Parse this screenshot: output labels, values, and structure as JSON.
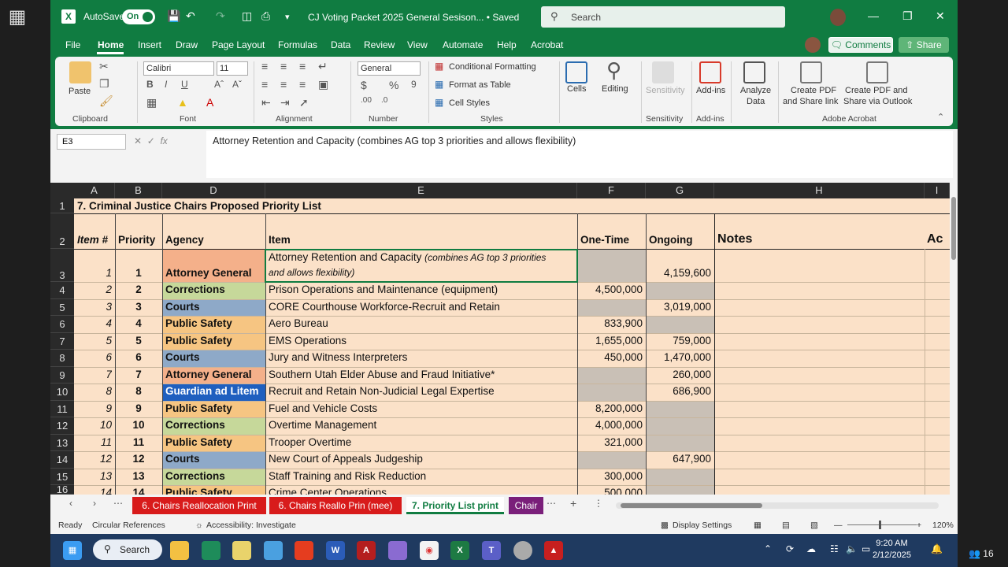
{
  "title_bar": {
    "autosave_label": "AutoSave",
    "autosave_state": "On",
    "doc_title": "CJ Voting Packet 2025 General Sesison... • Saved",
    "search_placeholder": "Search"
  },
  "menu": {
    "items": [
      "File",
      "Home",
      "Insert",
      "Draw",
      "Page Layout",
      "Formulas",
      "Data",
      "Review",
      "View",
      "Automate",
      "Help",
      "Acrobat"
    ],
    "active": "Home",
    "comments": "Comments",
    "share": "Share"
  },
  "ribbon": {
    "paste": "Paste",
    "font_name": "Calibri",
    "font_size": "11",
    "number_format": "General",
    "conditional_formatting": "Conditional Formatting",
    "format_as_table": "Format as Table",
    "cell_styles": "Cell Styles",
    "cells": "Cells",
    "editing": "Editing",
    "sensitivity": "Sensitivity",
    "add_ins": "Add-ins",
    "analyze_data_1": "Analyze",
    "analyze_data_2": "Data",
    "create_pdf_link_1": "Create PDF",
    "create_pdf_link_2": "and Share link",
    "create_pdf_outlook_1": "Create PDF and",
    "create_pdf_outlook_2": "Share via Outlook",
    "groups": {
      "clipboard": "Clipboard",
      "font": "Font",
      "alignment": "Alignment",
      "number": "Number",
      "styles": "Styles",
      "sensitivity": "Sensitivity",
      "add_ins": "Add-ins",
      "adobe_acrobat": "Adobe Acrobat"
    }
  },
  "formula_bar": {
    "name_box": "E3",
    "fx": "fx",
    "formula": "Attorney Retention and Capacity (combines AG top 3 priorities and allows flexibility)"
  },
  "sheet": {
    "columns": [
      "A",
      "B",
      "D",
      "E",
      "F",
      "G",
      "H",
      "I"
    ],
    "title": "7. Criminal Justice Chairs Proposed Priority List",
    "headers": {
      "item": "Item #",
      "priority": "Priority",
      "agency": "Agency",
      "item_name": "Item",
      "one_time": "One-Time",
      "ongoing": "Ongoing",
      "notes": "Notes",
      "next": "Ac"
    },
    "row3": {
      "item": "1",
      "priority": "1",
      "agency": "Attorney General",
      "name_line1": "Attorney Retention and Capacity ",
      "name_line1_italic": "(combines AG top 3 priorities",
      "name_line2": "and allows flexibility)",
      "one_time": "",
      "ongoing": "4,159,600"
    },
    "rows": [
      {
        "row": "4",
        "item": "2",
        "priority": "2",
        "agency": "Corrections",
        "name": "Prison Operations and Maintenance (equipment)",
        "one_time": "4,500,000",
        "ongoing": ""
      },
      {
        "row": "5",
        "item": "3",
        "priority": "3",
        "agency": "Courts",
        "name": "CORE Courthouse Workforce-Recruit and Retain",
        "one_time": "",
        "ongoing": "3,019,000"
      },
      {
        "row": "6",
        "item": "4",
        "priority": "4",
        "agency": "Public Safety",
        "name": "Aero Bureau",
        "one_time": "833,900",
        "ongoing": ""
      },
      {
        "row": "7",
        "item": "5",
        "priority": "5",
        "agency": "Public Safety",
        "name": "EMS Operations",
        "one_time": "1,655,000",
        "ongoing": "759,000"
      },
      {
        "row": "8",
        "item": "6",
        "priority": "6",
        "agency": "Courts",
        "name": "Jury and Witness Interpreters",
        "one_time": "450,000",
        "ongoing": "1,470,000"
      },
      {
        "row": "9",
        "item": "7",
        "priority": "7",
        "agency": "Attorney General",
        "name": "Southern Utah Elder Abuse and Fraud Initiative*",
        "one_time": "",
        "ongoing": "260,000"
      },
      {
        "row": "10",
        "item": "8",
        "priority": "8",
        "agency": "Guardian ad Litem",
        "name": "Recruit and Retain Non-Judicial Legal Expertise",
        "one_time": "",
        "ongoing": "686,900"
      },
      {
        "row": "11",
        "item": "9",
        "priority": "9",
        "agency": "Public Safety",
        "name": "Fuel and Vehicle Costs",
        "one_time": "8,200,000",
        "ongoing": ""
      },
      {
        "row": "12",
        "item": "10",
        "priority": "10",
        "agency": "Corrections",
        "name": "Overtime Management",
        "one_time": "4,000,000",
        "ongoing": ""
      },
      {
        "row": "13",
        "item": "11",
        "priority": "11",
        "agency": "Public Safety",
        "name": "Trooper Overtime",
        "one_time": "321,000",
        "ongoing": ""
      },
      {
        "row": "14",
        "item": "12",
        "priority": "12",
        "agency": "Courts",
        "name": "New Court of Appeals Judgeship",
        "one_time": "",
        "ongoing": "647,900"
      },
      {
        "row": "15",
        "item": "13",
        "priority": "13",
        "agency": "Corrections",
        "name": "Staff Training and Risk Reduction",
        "one_time": "300,000",
        "ongoing": ""
      },
      {
        "row": "16",
        "item": "14",
        "priority": "14",
        "agency": "Public Safety",
        "name": "Crime Center Operations",
        "one_time": "500,000",
        "ongoing": ""
      }
    ],
    "agency_colors": {
      "Attorney General": "#f4b08a",
      "Corrections": "#c6d89a",
      "Courts": "#8ea9c8",
      "Public Safety": "#f6c582",
      "Guardian ad Litem": "#1f5fbf"
    }
  },
  "sheet_tabs": [
    {
      "label": "6. Chairs Reallocation Print",
      "color": "#d81b1b",
      "active": false
    },
    {
      "label": "6. Chairs Reallo Prin (mee)",
      "color": "#d81b1b",
      "active": false
    },
    {
      "label": "7. Priority List print",
      "color": "#f3f3f3",
      "active": true
    },
    {
      "label": "Chair",
      "color": "#7a1f7a",
      "active": false
    }
  ],
  "status_bar": {
    "ready": "Ready",
    "circular": "Circular References",
    "accessibility": "Accessibility: Investigate",
    "display_settings": "Display Settings",
    "zoom": "120%"
  },
  "taskbar": {
    "search": "Search",
    "time": "9:20 AM",
    "date": "2/12/2025"
  },
  "participants": "16"
}
